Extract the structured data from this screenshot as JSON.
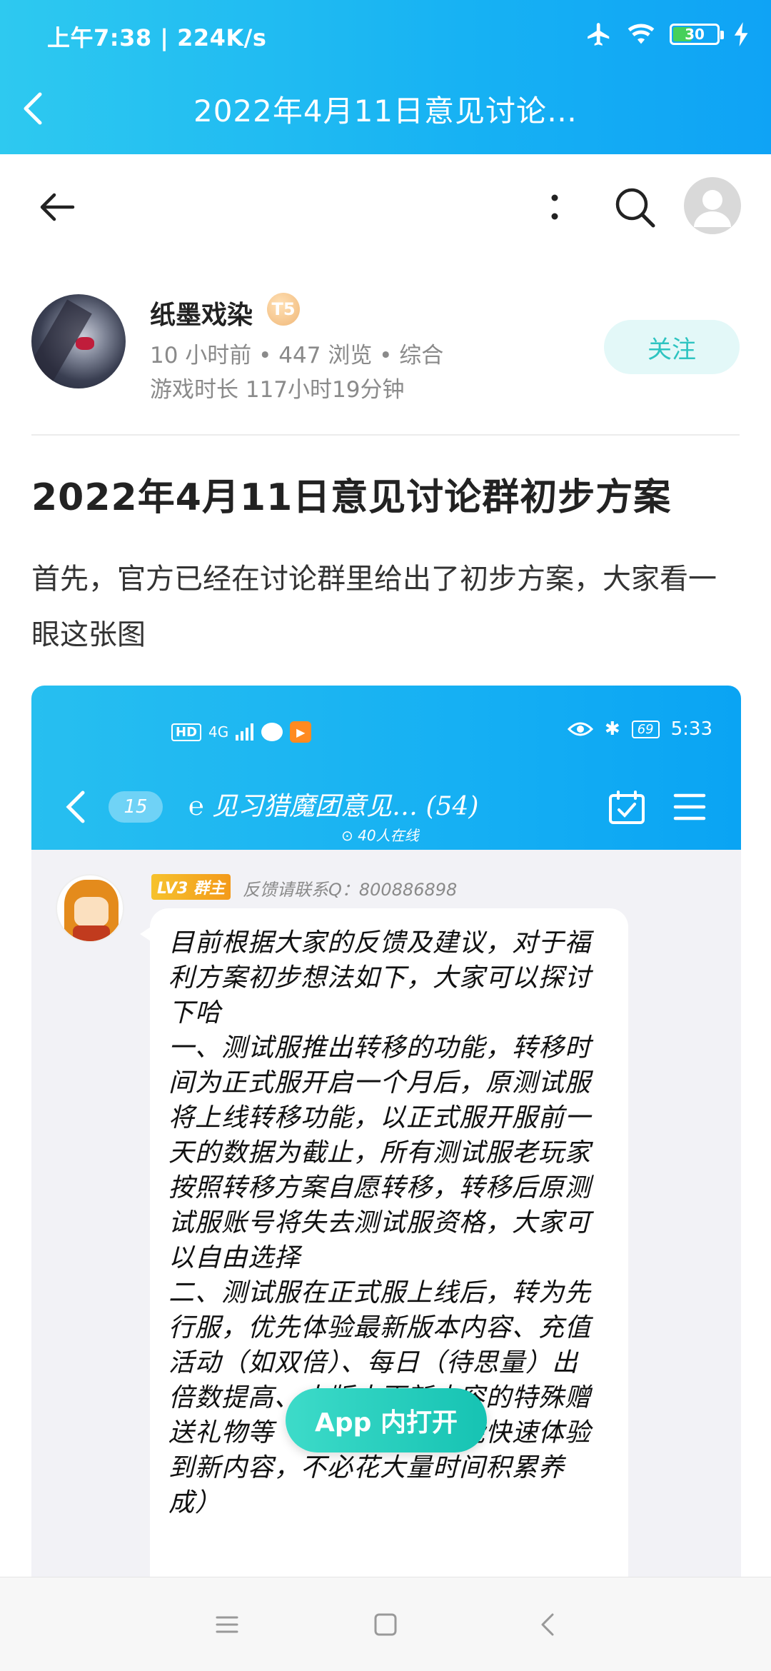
{
  "status_bar": {
    "time_speed": "上午7:38 | 224K/s",
    "battery": "30"
  },
  "title_bar": {
    "title": "2022年4月11日意见讨论…"
  },
  "author": {
    "name": "纸墨戏染",
    "level_badge": "T5",
    "meta": "10 小时前 • 447 浏览 • 综合",
    "playtime": "游戏时长 117小时19分钟",
    "follow_label": "关注"
  },
  "post": {
    "title": "2022年4月11日意见讨论群初步方案",
    "body": "首先，官方已经在讨论群里给出了初步方案，大家看一眼这张图"
  },
  "embedded_screenshot": {
    "status_left_hd": "HD",
    "status_left_net": "4G",
    "battery": "69",
    "time": "5:33",
    "unread_count": "15",
    "group_title": "见习猎魔团意见…",
    "member_count": "(54)",
    "online": "40人在线",
    "member_tag": "LV3 群主",
    "contact": "反馈请联系Q：800886898",
    "message": "目前根据大家的反馈及建议，对于福利方案初步想法如下，大家可以探讨下哈\n一、测试服推出转移的功能，转移时间为正式服开启一个月后，原测试服将上线转移功能，以正式服开服前一天的数据为截止，所有测试服老玩家按照转移方案自愿转移，转移后原测试服账号将失去测试服资格，大家可以自由选择\n二、测试服在正式服上线后，转为先行服，优先体验最新版本内容、充值活动（如双倍）、每日（待思量）出倍数提高、大版本更新内容的特殊赠送礼物等（主要方便大家能快速体验到新内容，不必花大量时间积累养成）"
  },
  "open_app_label": "App 内打开",
  "colors": {
    "brand_blue": "#17b2f3",
    "follow_text": "#2ec4c1",
    "open_app": "#16c3b3"
  }
}
